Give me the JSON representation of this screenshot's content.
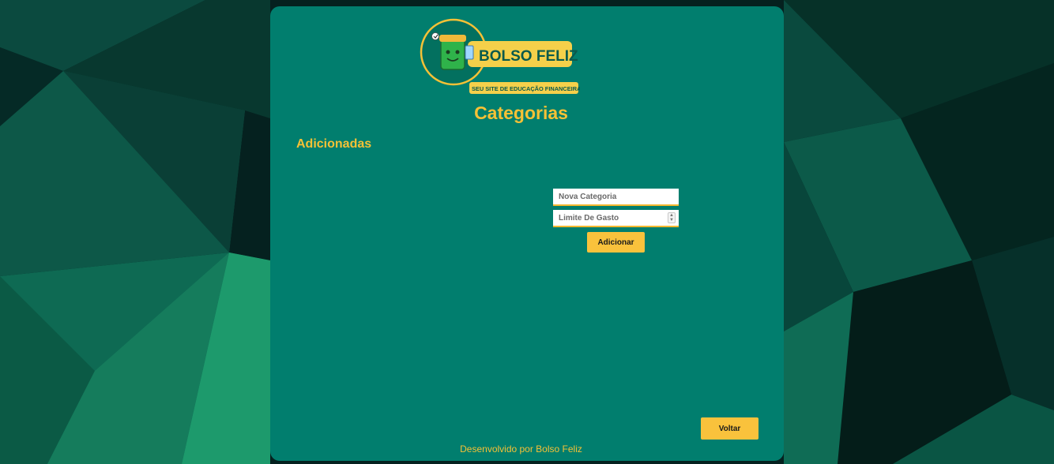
{
  "logo": {
    "brand_name": "BOLSO FELIZ",
    "tagline": "SEU SITE DE EDUCAÇÃO FINANCEIRA"
  },
  "page": {
    "title": "Categorias",
    "section_title": "Adicionadas"
  },
  "form": {
    "name_placeholder": "Nova Categoria",
    "name_value": "",
    "limit_placeholder": "Limite De Gasto",
    "limit_value": "",
    "add_label": "Adicionar"
  },
  "navigation": {
    "back_label": "Voltar"
  },
  "footer": {
    "text": "Desenvolvido por Bolso Feliz"
  },
  "colors": {
    "card_background": "#017e6e",
    "accent": "#f5c136",
    "button": "#f9c23c",
    "page_background": "#05211f"
  }
}
